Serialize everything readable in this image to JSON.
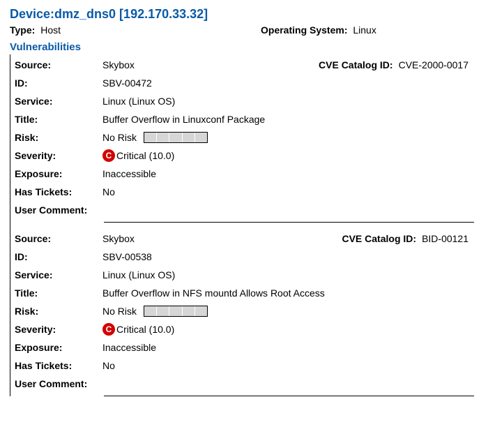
{
  "header": {
    "device_title": "Device:dmz_dns0 [192.170.33.32]",
    "type_label": "Type:",
    "type_value": "Host",
    "os_label": "Operating System:",
    "os_value": "Linux",
    "section_title": "Vulnerabilities"
  },
  "labels": {
    "source": "Source:",
    "cve": "CVE Catalog ID:",
    "id": "ID:",
    "service": "Service:",
    "title": "Title:",
    "risk": "Risk:",
    "severity": "Severity:",
    "exposure": "Exposure:",
    "has_tickets": "Has Tickets:",
    "user_comment": "User Comment:"
  },
  "vulns": [
    {
      "source": "Skybox",
      "cve": "CVE-2000-0017",
      "id": "SBV-00472",
      "service": "Linux (Linux OS)",
      "title": "Buffer Overflow in Linuxconf Package",
      "risk": "No Risk",
      "severity_letter": "C",
      "severity_text": "Critical (10.0)",
      "exposure": "Inaccessible",
      "has_tickets": "No",
      "user_comment": ""
    },
    {
      "source": "Skybox",
      "cve": "BID-00121",
      "id": "SBV-00538",
      "service": "Linux (Linux OS)",
      "title": "Buffer Overflow in NFS mountd Allows Root Access",
      "risk": "No Risk",
      "severity_letter": "C",
      "severity_text": "Critical (10.0)",
      "exposure": "Inaccessible",
      "has_tickets": "No",
      "user_comment": ""
    }
  ]
}
